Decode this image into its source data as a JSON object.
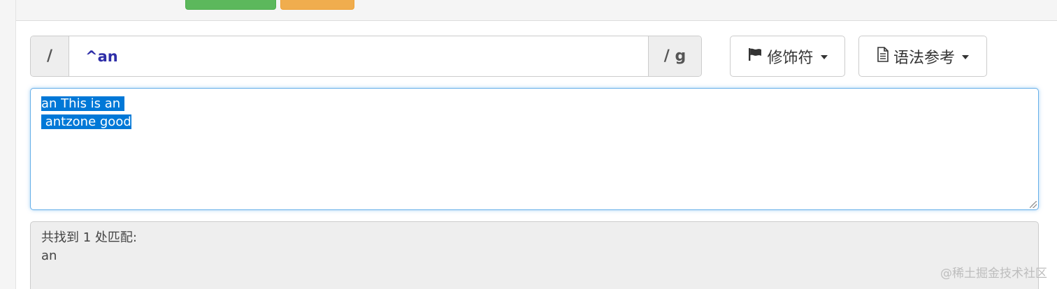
{
  "regex": {
    "open_delimiter": "/",
    "pattern": "^an",
    "close_delimiter_flags": "/ g"
  },
  "toolbar": {
    "flags_label": "修饰符",
    "syntax_label": "语法参考"
  },
  "test_text": {
    "line1": "an This is an ",
    "line2": " antzone good"
  },
  "result": {
    "summary": "共找到 1 处匹配:",
    "matches": [
      "an"
    ]
  },
  "watermark": "@稀土掘金技术社区",
  "colors": {
    "pattern_text": "#2e2ea8",
    "selection": "#0078d7",
    "focus_border": "#66afe9"
  }
}
